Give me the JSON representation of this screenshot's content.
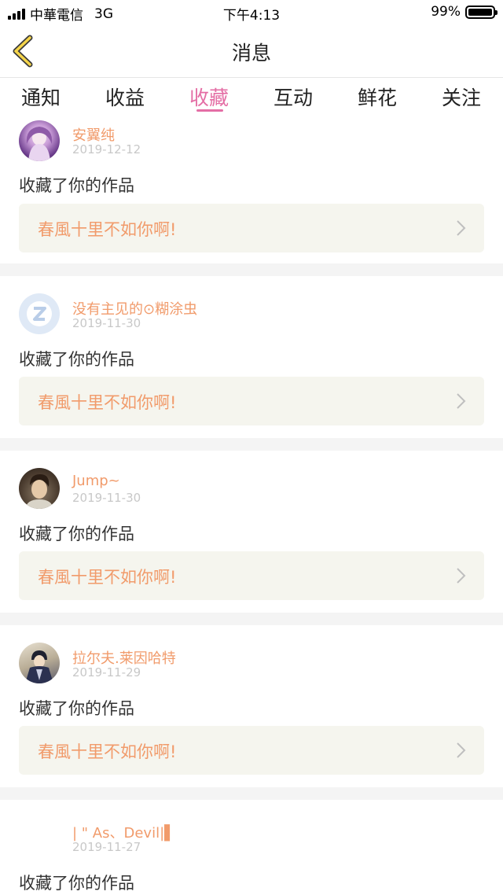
{
  "status_bar": {
    "carrier": "中華電信",
    "network": "3G",
    "time": "下午4:13",
    "battery": "99%"
  },
  "navbar": {
    "title": "消息"
  },
  "tabs": [
    {
      "label": "通知",
      "active": false
    },
    {
      "label": "收益",
      "active": false
    },
    {
      "label": "收藏",
      "active": true
    },
    {
      "label": "互动",
      "active": false
    },
    {
      "label": "鲜花",
      "active": false
    },
    {
      "label": "关注",
      "active": false
    }
  ],
  "colors": {
    "accent": "#e46ea5",
    "username": "#f19b6b",
    "card_bg": "#f5f5ee"
  },
  "messages": [
    {
      "username": "安翼纯",
      "date": "2019-12-12",
      "action": "收藏了你的作品",
      "work_title": "春風十里不如你啊!",
      "avatar": "anime-avatar"
    },
    {
      "username": "没有主见的⊙糊涂虫",
      "date": "2019-11-30",
      "action": "收藏了你的作品",
      "work_title": "春風十里不如你啊!",
      "avatar": "default-qq-avatar"
    },
    {
      "username": "Jump~",
      "date": "2019-11-30",
      "action": "收藏了你的作品",
      "work_title": "春風十里不如你啊!",
      "avatar": "photo-avatar"
    },
    {
      "username": "拉尔夫.莱因哈特",
      "date": "2019-11-29",
      "action": "收藏了你的作品",
      "work_title": "春風十里不如你啊!",
      "avatar": "anime-avatar"
    },
    {
      "username": "| \" As、Devil|▌",
      "date": "2019-11-27",
      "action": "收藏了你的作品",
      "work_title": "",
      "avatar": ""
    }
  ]
}
